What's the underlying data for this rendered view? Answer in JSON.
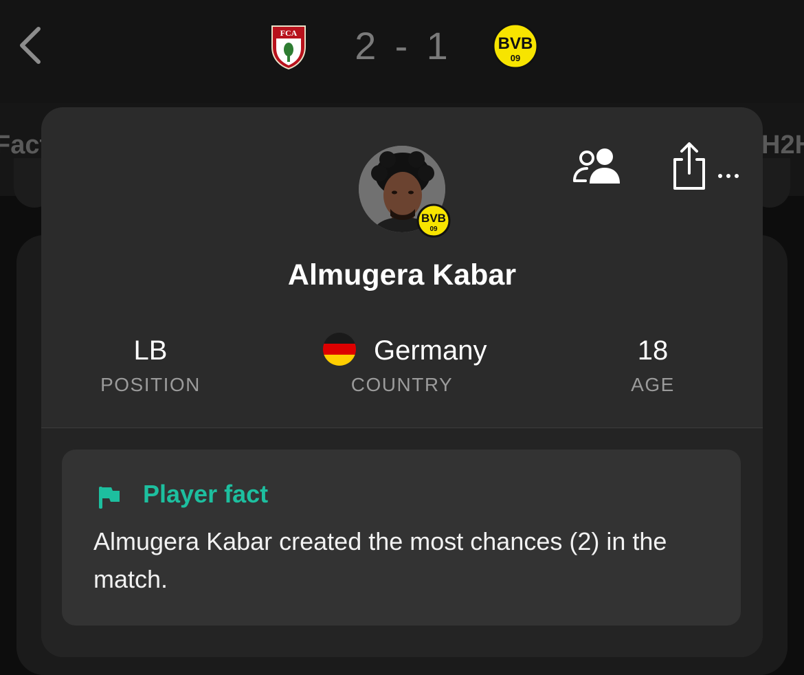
{
  "header": {
    "home_score": "2",
    "separator": "-",
    "away_score": "1",
    "home_team_crest": "FCA",
    "away_team_crest": "BVB 09"
  },
  "tabs": {
    "left_partial": "Fact",
    "right_partial": "H2H"
  },
  "player": {
    "name": "Almugera Kabar",
    "club_badge": "BVB 09",
    "stats": [
      {
        "value": "LB",
        "label": "POSITION"
      },
      {
        "value": "Germany",
        "label": "COUNTRY"
      },
      {
        "value": "18",
        "label": "AGE"
      }
    ]
  },
  "actions": {
    "friends_icon": "people-icon",
    "share_icon": "share-icon",
    "more_icon": "more-icon"
  },
  "fact": {
    "title": "Player fact",
    "text": "Almugera Kabar created the most chances (2) in the match."
  },
  "colors": {
    "accent": "#1dbf9f",
    "bvb_yellow": "#f7e400",
    "fca_red": "#b8121c"
  }
}
